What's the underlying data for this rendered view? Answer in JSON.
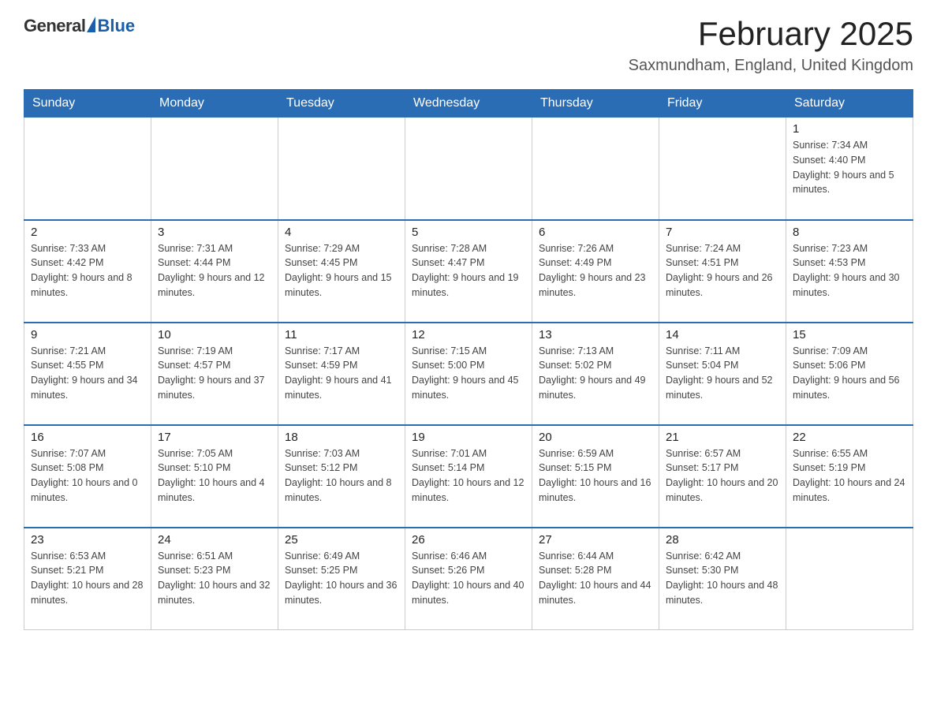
{
  "header": {
    "logo_general": "General",
    "logo_blue": "Blue",
    "month_title": "February 2025",
    "location": "Saxmundham, England, United Kingdom"
  },
  "weekdays": [
    "Sunday",
    "Monday",
    "Tuesday",
    "Wednesday",
    "Thursday",
    "Friday",
    "Saturday"
  ],
  "weeks": [
    [
      {
        "day": "",
        "info": ""
      },
      {
        "day": "",
        "info": ""
      },
      {
        "day": "",
        "info": ""
      },
      {
        "day": "",
        "info": ""
      },
      {
        "day": "",
        "info": ""
      },
      {
        "day": "",
        "info": ""
      },
      {
        "day": "1",
        "info": "Sunrise: 7:34 AM\nSunset: 4:40 PM\nDaylight: 9 hours and 5 minutes."
      }
    ],
    [
      {
        "day": "2",
        "info": "Sunrise: 7:33 AM\nSunset: 4:42 PM\nDaylight: 9 hours and 8 minutes."
      },
      {
        "day": "3",
        "info": "Sunrise: 7:31 AM\nSunset: 4:44 PM\nDaylight: 9 hours and 12 minutes."
      },
      {
        "day": "4",
        "info": "Sunrise: 7:29 AM\nSunset: 4:45 PM\nDaylight: 9 hours and 15 minutes."
      },
      {
        "day": "5",
        "info": "Sunrise: 7:28 AM\nSunset: 4:47 PM\nDaylight: 9 hours and 19 minutes."
      },
      {
        "day": "6",
        "info": "Sunrise: 7:26 AM\nSunset: 4:49 PM\nDaylight: 9 hours and 23 minutes."
      },
      {
        "day": "7",
        "info": "Sunrise: 7:24 AM\nSunset: 4:51 PM\nDaylight: 9 hours and 26 minutes."
      },
      {
        "day": "8",
        "info": "Sunrise: 7:23 AM\nSunset: 4:53 PM\nDaylight: 9 hours and 30 minutes."
      }
    ],
    [
      {
        "day": "9",
        "info": "Sunrise: 7:21 AM\nSunset: 4:55 PM\nDaylight: 9 hours and 34 minutes."
      },
      {
        "day": "10",
        "info": "Sunrise: 7:19 AM\nSunset: 4:57 PM\nDaylight: 9 hours and 37 minutes."
      },
      {
        "day": "11",
        "info": "Sunrise: 7:17 AM\nSunset: 4:59 PM\nDaylight: 9 hours and 41 minutes."
      },
      {
        "day": "12",
        "info": "Sunrise: 7:15 AM\nSunset: 5:00 PM\nDaylight: 9 hours and 45 minutes."
      },
      {
        "day": "13",
        "info": "Sunrise: 7:13 AM\nSunset: 5:02 PM\nDaylight: 9 hours and 49 minutes."
      },
      {
        "day": "14",
        "info": "Sunrise: 7:11 AM\nSunset: 5:04 PM\nDaylight: 9 hours and 52 minutes."
      },
      {
        "day": "15",
        "info": "Sunrise: 7:09 AM\nSunset: 5:06 PM\nDaylight: 9 hours and 56 minutes."
      }
    ],
    [
      {
        "day": "16",
        "info": "Sunrise: 7:07 AM\nSunset: 5:08 PM\nDaylight: 10 hours and 0 minutes."
      },
      {
        "day": "17",
        "info": "Sunrise: 7:05 AM\nSunset: 5:10 PM\nDaylight: 10 hours and 4 minutes."
      },
      {
        "day": "18",
        "info": "Sunrise: 7:03 AM\nSunset: 5:12 PM\nDaylight: 10 hours and 8 minutes."
      },
      {
        "day": "19",
        "info": "Sunrise: 7:01 AM\nSunset: 5:14 PM\nDaylight: 10 hours and 12 minutes."
      },
      {
        "day": "20",
        "info": "Sunrise: 6:59 AM\nSunset: 5:15 PM\nDaylight: 10 hours and 16 minutes."
      },
      {
        "day": "21",
        "info": "Sunrise: 6:57 AM\nSunset: 5:17 PM\nDaylight: 10 hours and 20 minutes."
      },
      {
        "day": "22",
        "info": "Sunrise: 6:55 AM\nSunset: 5:19 PM\nDaylight: 10 hours and 24 minutes."
      }
    ],
    [
      {
        "day": "23",
        "info": "Sunrise: 6:53 AM\nSunset: 5:21 PM\nDaylight: 10 hours and 28 minutes."
      },
      {
        "day": "24",
        "info": "Sunrise: 6:51 AM\nSunset: 5:23 PM\nDaylight: 10 hours and 32 minutes."
      },
      {
        "day": "25",
        "info": "Sunrise: 6:49 AM\nSunset: 5:25 PM\nDaylight: 10 hours and 36 minutes."
      },
      {
        "day": "26",
        "info": "Sunrise: 6:46 AM\nSunset: 5:26 PM\nDaylight: 10 hours and 40 minutes."
      },
      {
        "day": "27",
        "info": "Sunrise: 6:44 AM\nSunset: 5:28 PM\nDaylight: 10 hours and 44 minutes."
      },
      {
        "day": "28",
        "info": "Sunrise: 6:42 AM\nSunset: 5:30 PM\nDaylight: 10 hours and 48 minutes."
      },
      {
        "day": "",
        "info": ""
      }
    ]
  ]
}
